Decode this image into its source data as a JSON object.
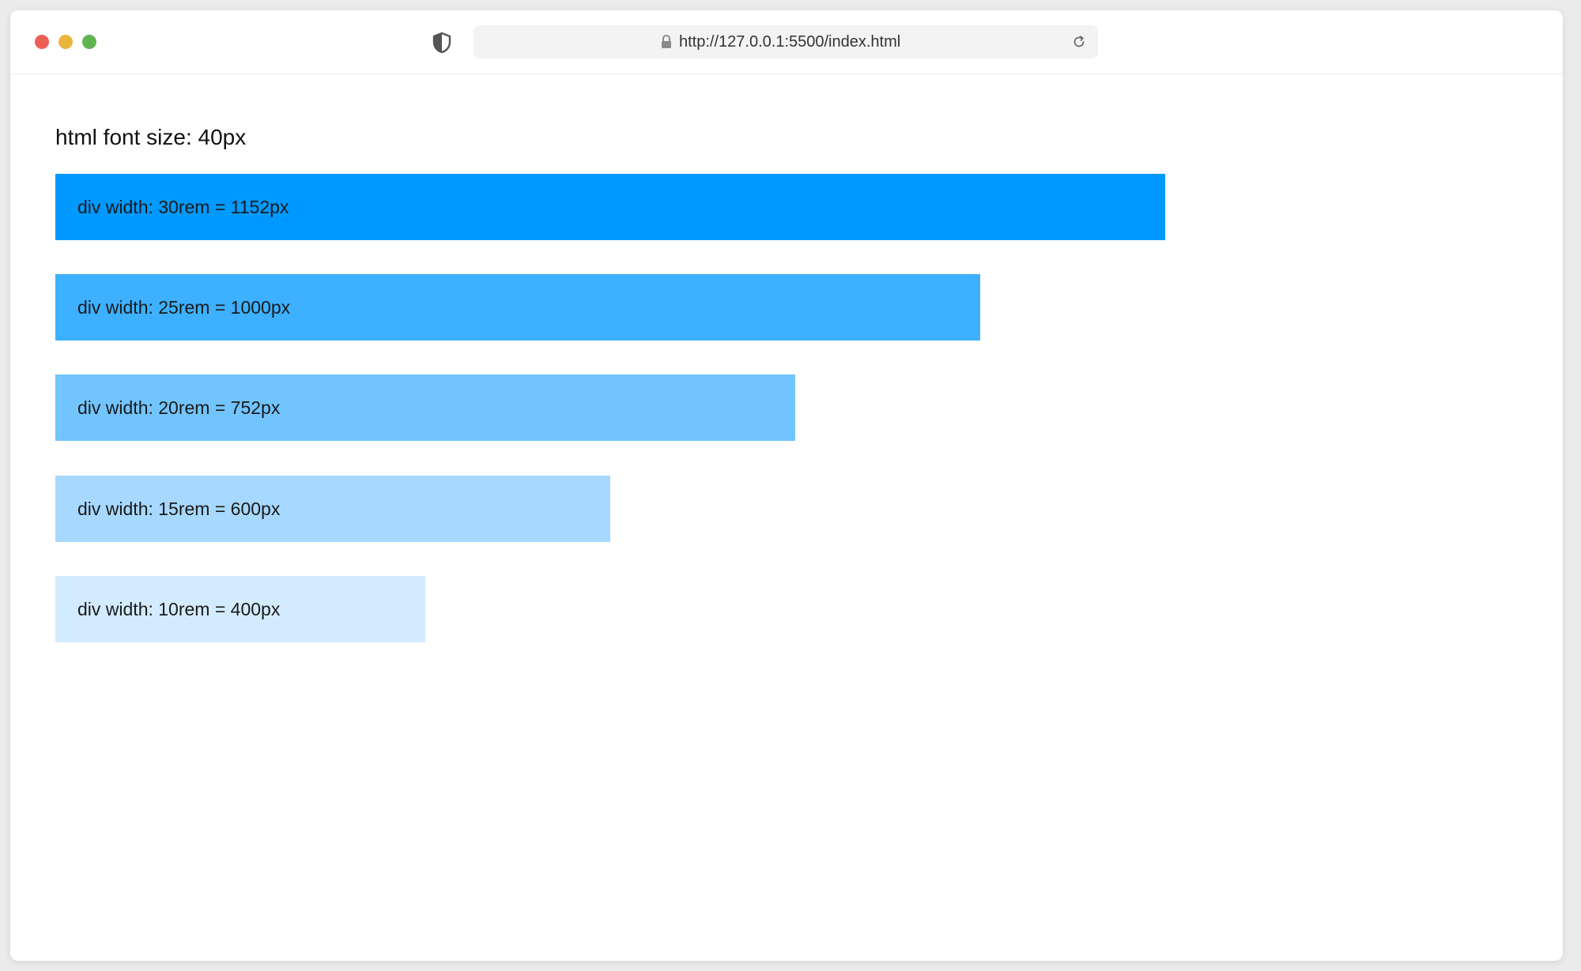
{
  "browser": {
    "url": "http://127.0.0.1:5500/index.html",
    "icons": {
      "shield": "shield-icon",
      "lock": "lock-icon",
      "reload": "reload-icon"
    }
  },
  "page": {
    "heading": "html font size: 40px",
    "bars": [
      {
        "label": "div width: 30rem = 1152px",
        "color": "#0099ff"
      },
      {
        "label": "div width: 25rem = 1000px",
        "color": "#3db0ff"
      },
      {
        "label": "div width: 20rem = 752px",
        "color": "#72c4ff"
      },
      {
        "label": "div width: 15rem = 600px",
        "color": "#a7d8ff"
      },
      {
        "label": "div width: 10rem = 400px",
        "color": "#d3ebff"
      }
    ]
  }
}
